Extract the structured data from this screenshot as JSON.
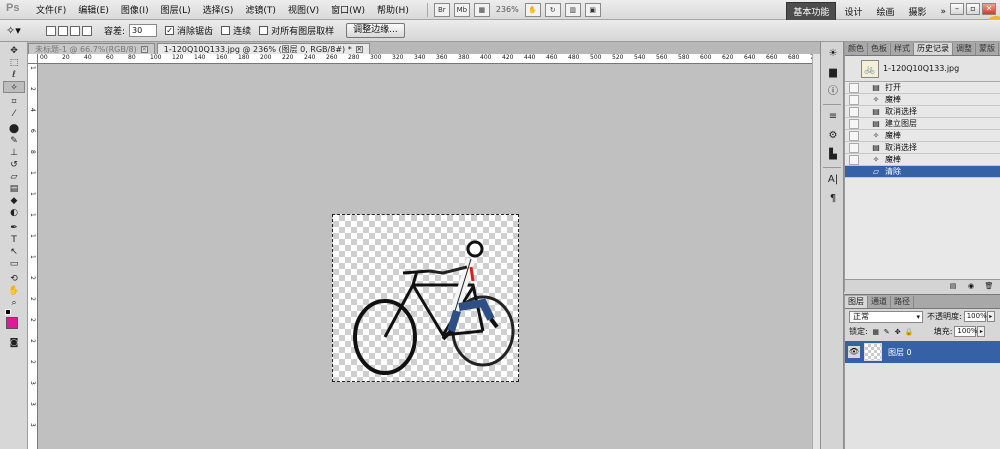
{
  "app": {
    "logo": "Ps"
  },
  "menu": [
    "文件(F)",
    "编辑(E)",
    "图像(I)",
    "图层(L)",
    "选择(S)",
    "滤镜(T)",
    "视图(V)",
    "窗口(W)",
    "帮助(H)"
  ],
  "menubar_icons": {
    "br": "Br",
    "mb": "Mb",
    "zoom": "236%"
  },
  "workspace": {
    "active": "基本功能",
    "items": [
      "设计",
      "绘画",
      "摄影"
    ],
    "more": "»"
  },
  "options": {
    "tolerance_label": "容差:",
    "tolerance_value": "30",
    "antialias": "消除锯齿",
    "contiguous": "连续",
    "sample_all": "对所有图层取样",
    "refine_edge": "调整边缘..."
  },
  "doc_tabs": [
    {
      "label": "未标题-1 @ 66.7%(RGB/8)",
      "active": false
    },
    {
      "label": "1-120Q10Q133.jpg @ 236% (图层 0, RGB/8#) *",
      "active": true
    }
  ],
  "ruler_top": [
    "00",
    "20",
    "40",
    "60",
    "80",
    "100",
    "120",
    "140",
    "160",
    "180",
    "200",
    "220",
    "240",
    "260",
    "280",
    "300",
    "320",
    "340",
    "360",
    "380",
    "400",
    "420",
    "440",
    "460",
    "480",
    "500",
    "520",
    "540",
    "560",
    "580",
    "600",
    "620",
    "640",
    "660",
    "680",
    "700"
  ],
  "ruler_left": [
    "1",
    "2",
    "4",
    "6",
    "8",
    "1",
    "1",
    "1",
    "1",
    "1",
    "2",
    "2",
    "2",
    "2",
    "2",
    "3",
    "3",
    "3"
  ],
  "history_tabs": [
    "颜色",
    "色板",
    "样式",
    "历史记录",
    "调整",
    "蒙版"
  ],
  "history": {
    "snapshot": "1-120Q10Q133.jpg",
    "items": [
      {
        "icon": "doc",
        "label": "打开"
      },
      {
        "icon": "wand",
        "label": "魔棒"
      },
      {
        "icon": "doc",
        "label": "取消选择"
      },
      {
        "icon": "doc",
        "label": "建立图层"
      },
      {
        "icon": "wand",
        "label": "魔棒"
      },
      {
        "icon": "doc",
        "label": "取消选择"
      },
      {
        "icon": "wand",
        "label": "魔棒"
      },
      {
        "icon": "eraser",
        "label": "清除",
        "selected": true
      }
    ]
  },
  "layer_tabs": [
    "图层",
    "通道",
    "路径"
  ],
  "layers": {
    "blend_mode": "正常",
    "opacity_label": "不透明度:",
    "opacity_value": "100%",
    "lock_label": "锁定:",
    "fill_label": "填充:",
    "fill_value": "100%",
    "items": [
      {
        "name": "图层 0"
      }
    ]
  },
  "colors": {
    "foreground": "#e0199a",
    "selection": "#3661a7"
  }
}
